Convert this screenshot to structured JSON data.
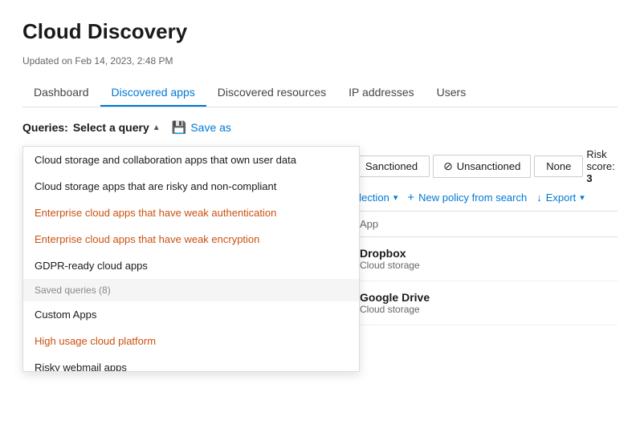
{
  "page": {
    "title": "Cloud Discovery",
    "updated_text": "Updated on Feb 14, 2023, 2:48 PM"
  },
  "tabs": [
    {
      "id": "dashboard",
      "label": "Dashboard",
      "active": false
    },
    {
      "id": "discovered-apps",
      "label": "Discovered apps",
      "active": true
    },
    {
      "id": "discovered-resources",
      "label": "Discovered resources",
      "active": false
    },
    {
      "id": "ip-addresses",
      "label": "IP addresses",
      "active": false
    },
    {
      "id": "users",
      "label": "Users",
      "active": false
    }
  ],
  "toolbar": {
    "queries_prefix": "Queries:",
    "select_query_label": "Select a query",
    "save_as_label": "Save as"
  },
  "dropdown": {
    "items": [
      {
        "id": "item1",
        "label": "Cloud storage and collaboration apps that own user data",
        "style": "normal"
      },
      {
        "id": "item2",
        "label": "Cloud storage apps that are risky and non-compliant",
        "style": "normal"
      },
      {
        "id": "item3",
        "label": "Enterprise cloud apps that have weak authentication",
        "style": "orange"
      },
      {
        "id": "item4",
        "label": "Enterprise cloud apps that have weak encryption",
        "style": "orange"
      },
      {
        "id": "item5",
        "label": "GDPR-ready cloud apps",
        "style": "normal"
      },
      {
        "id": "saved-header",
        "label": "Saved queries (8)",
        "style": "section-header"
      },
      {
        "id": "item6",
        "label": "Custom Apps",
        "style": "normal"
      },
      {
        "id": "item7",
        "label": "High usage cloud platform",
        "style": "orange"
      },
      {
        "id": "item8",
        "label": "Risky webmail apps",
        "style": "normal"
      }
    ]
  },
  "filter_bar": {
    "sanctioned_label": "Sanctioned",
    "unsanctioned_label": "Unsanctioned",
    "none_label": "None",
    "risk_score_label": "Risk score:",
    "risk_score_value": "3"
  },
  "action_bar": {
    "selection_label": "election",
    "new_policy_label": "New policy from search",
    "export_label": "Export"
  },
  "table": {
    "col_app_label": "App",
    "rows": [
      {
        "name": "Dropbox",
        "category": "Cloud storage"
      },
      {
        "name": "Google Drive",
        "category": "Cloud storage"
      }
    ]
  }
}
